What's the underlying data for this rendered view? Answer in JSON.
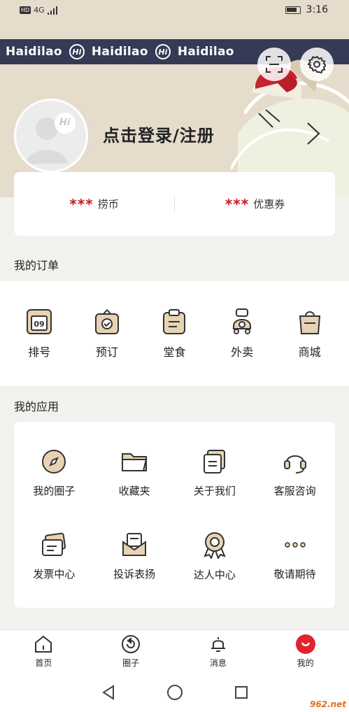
{
  "status_bar": {
    "network": "4G",
    "hd": "HD",
    "time": "3:16"
  },
  "banner": {
    "brand": "Haidilao",
    "logo_text": "Hi"
  },
  "profile": {
    "login_text": "点击登录/注册",
    "avatar_badge": "Hi"
  },
  "points": [
    {
      "masked": "***",
      "label": "捞币"
    },
    {
      "masked": "***",
      "label": "优惠券"
    }
  ],
  "orders": {
    "title": "我的订单",
    "items": [
      {
        "label": "排号",
        "icon": "queue-number-icon",
        "icon_text": "09"
      },
      {
        "label": "预订",
        "icon": "reservation-icon"
      },
      {
        "label": "堂食",
        "icon": "dine-in-icon"
      },
      {
        "label": "外卖",
        "icon": "delivery-icon"
      },
      {
        "label": "商城",
        "icon": "mall-bag-icon"
      }
    ]
  },
  "apps": {
    "title": "我的应用",
    "items": [
      {
        "label": "我的圈子",
        "icon": "compass-icon"
      },
      {
        "label": "收藏夹",
        "icon": "folder-icon"
      },
      {
        "label": "关于我们",
        "icon": "document-icon"
      },
      {
        "label": "客服咨询",
        "icon": "headset-icon"
      },
      {
        "label": "发票中心",
        "icon": "invoice-icon"
      },
      {
        "label": "投诉表扬",
        "icon": "mail-icon"
      },
      {
        "label": "达人中心",
        "icon": "badge-icon"
      },
      {
        "label": "敬请期待",
        "icon": "more-dots-icon"
      }
    ]
  },
  "bottom_nav": [
    {
      "label": "首页",
      "icon": "home-icon"
    },
    {
      "label": "圈子",
      "icon": "circle-icon"
    },
    {
      "label": "消息",
      "icon": "bell-icon"
    },
    {
      "label": "我的",
      "icon": "me-icon",
      "active": true
    }
  ],
  "watermark": "962.net",
  "colors": {
    "accent": "#e1242d",
    "banner": "#353a55",
    "header_bg": "#e6dccc",
    "icon_fill": "#e7d3b4"
  }
}
